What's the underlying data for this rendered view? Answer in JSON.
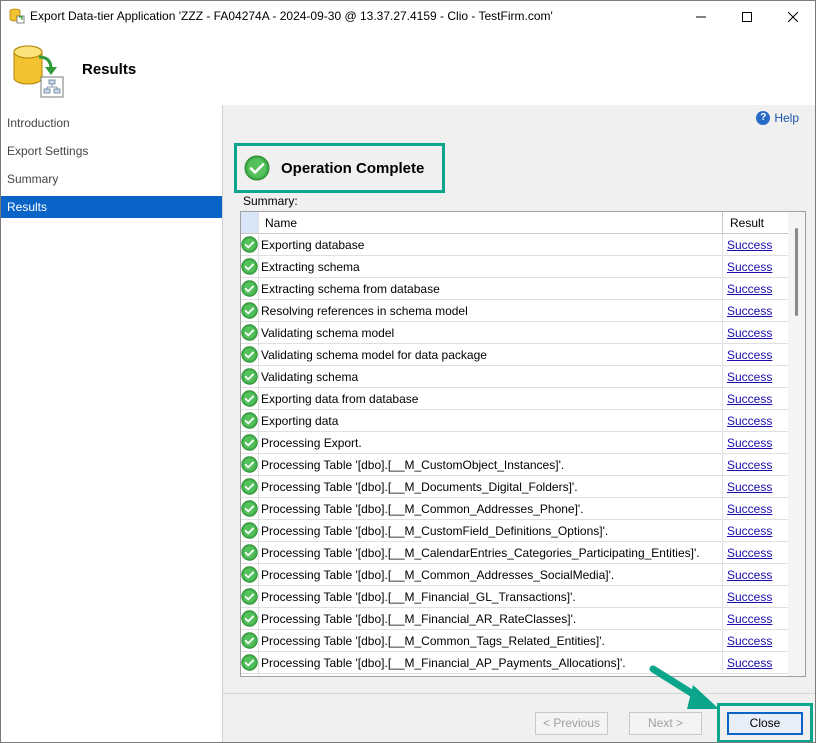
{
  "window": {
    "title": "Export Data-tier Application 'ZZZ - FA04274A - 2024-09-30 @ 13.37.27.4159 - Clio - TestFirm.com'"
  },
  "header": {
    "title": "Results"
  },
  "sidebar": {
    "items": [
      {
        "label": "Introduction",
        "active": false
      },
      {
        "label": "Export Settings",
        "active": false
      },
      {
        "label": "Summary",
        "active": false
      },
      {
        "label": "Results",
        "active": true
      }
    ]
  },
  "help": {
    "label": "Help"
  },
  "status": {
    "text": "Operation Complete"
  },
  "summary": {
    "label": "Summary:",
    "columns": [
      "Name",
      "Result"
    ],
    "rows": [
      {
        "name": "Exporting database",
        "result": "Success"
      },
      {
        "name": "Extracting schema",
        "result": "Success"
      },
      {
        "name": "Extracting schema from database",
        "result": "Success"
      },
      {
        "name": "Resolving references in schema model",
        "result": "Success"
      },
      {
        "name": "Validating schema model",
        "result": "Success"
      },
      {
        "name": "Validating schema model for data package",
        "result": "Success"
      },
      {
        "name": "Validating schema",
        "result": "Success"
      },
      {
        "name": "Exporting data from database",
        "result": "Success"
      },
      {
        "name": "Exporting data",
        "result": "Success"
      },
      {
        "name": "Processing Export.",
        "result": "Success"
      },
      {
        "name": "Processing Table '[dbo].[__M_CustomObject_Instances]'.",
        "result": "Success"
      },
      {
        "name": "Processing Table '[dbo].[__M_Documents_Digital_Folders]'.",
        "result": "Success"
      },
      {
        "name": "Processing Table '[dbo].[__M_Common_Addresses_Phone]'.",
        "result": "Success"
      },
      {
        "name": "Processing Table '[dbo].[__M_CustomField_Definitions_Options]'.",
        "result": "Success"
      },
      {
        "name": "Processing Table '[dbo].[__M_CalendarEntries_Categories_Participating_Entities]'.",
        "result": "Success"
      },
      {
        "name": "Processing Table '[dbo].[__M_Common_Addresses_SocialMedia]'.",
        "result": "Success"
      },
      {
        "name": "Processing Table '[dbo].[__M_Financial_GL_Transactions]'.",
        "result": "Success"
      },
      {
        "name": "Processing Table '[dbo].[__M_Financial_AR_RateClasses]'.",
        "result": "Success"
      },
      {
        "name": "Processing Table '[dbo].[__M_Common_Tags_Related_Entities]'.",
        "result": "Success"
      },
      {
        "name": "Processing Table '[dbo].[__M_Financial_AP_Payments_Allocations]'.",
        "result": "Success"
      }
    ]
  },
  "footer": {
    "previous_label": "< Previous",
    "next_label": "Next >",
    "close_label": "Close"
  },
  "colors": {
    "accent": "#0a64c8",
    "highlight": "#0aa58a",
    "success_link": "#1a0dab"
  },
  "icons": {
    "app": "database-export-icon",
    "header": "database-export-icon",
    "status": "check-circle-icon",
    "help": "help-icon"
  }
}
